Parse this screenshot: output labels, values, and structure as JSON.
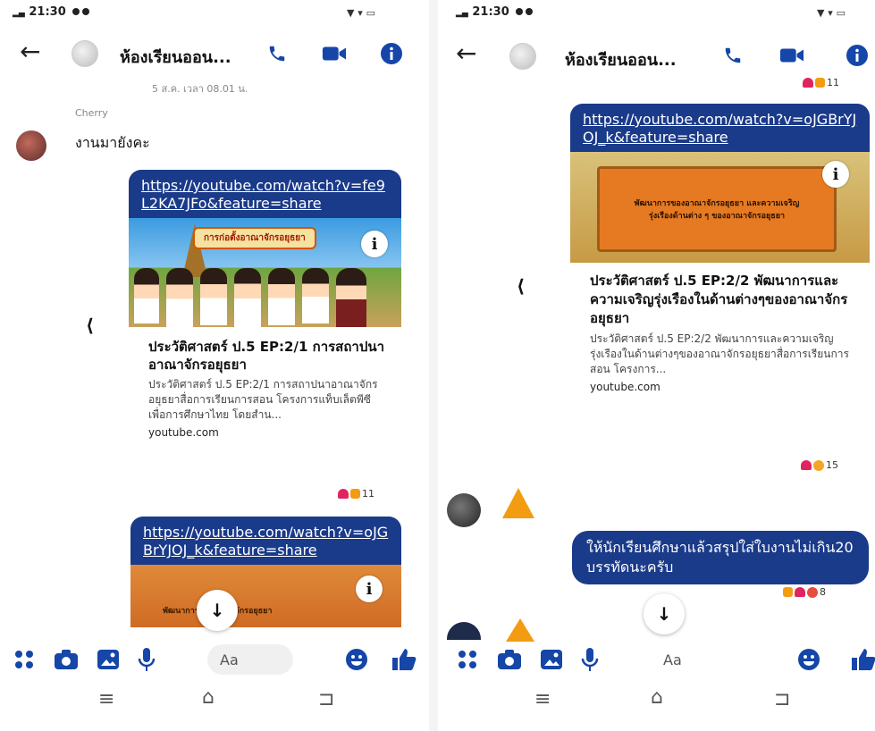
{
  "left": {
    "status": {
      "time": "21:30"
    },
    "header": {
      "title": "ห้องเรียนออน..."
    },
    "timestamp": "5 ส.ค. เวลา 08.01 น.",
    "sender_name": "Cherry",
    "message_text": "งานมายังคะ",
    "link1": {
      "url": "https://youtube.com/watch?v=fe9L2KA7JFo&feature=share",
      "thumb_banner": "การก่อตั้งอาณาจักรอยุธยา",
      "title": "ประวัติศาสตร์ ป.5 EP:2/1 การสถาปนาอาณาจักรอยุธยา",
      "desc": "ประวัติศาสตร์ ป.5 EP:2/1 การสถาปนาอาณาจักรอยุธยาสื่อการเรียนการสอน โครงการแท็บเล็ตพีซีเพื่อการศึกษาไทย โดยสำน...",
      "host": "youtube.com",
      "reaction_count": "11"
    },
    "link2": {
      "url": "https://youtube.com/watch?v=oJGBrYJOJ_k&feature=share",
      "thumb_banner": "พัฒนาการของอาณาจักรอยุธยา"
    },
    "composer": {
      "placeholder": "Aa"
    }
  },
  "right": {
    "status": {
      "time": "21:30"
    },
    "header": {
      "title": "ห้องเรียนออน..."
    },
    "top_reaction_count": "11",
    "link": {
      "url": "https://youtube.com/watch?v=oJGBrYJOJ_k&feature=share",
      "thumb_banner": "พัฒนาการของอาณาจักรอยุธยา และความเจริญรุ่งเรืองด้านต่าง ๆ ของอาณาจักรอยุธยา",
      "title": "ประวัติศาสตร์ ป.5 EP:2/2 พัฒนาการและความเจริญรุ่งเรืองในด้านต่างๆของอาณาจักรอยุธยา",
      "desc": "ประวัติศาสตร์ ป.5 EP:2/2 พัฒนาการและความเจริญรุ่งเรืองในด้านต่างๆของอาณาจักรอยุธยาสื่อการเรียนการสอน โครงการ...",
      "host": "youtube.com",
      "reaction_count": "15"
    },
    "message": {
      "text": "ให้นักเรียนศึกษาแล้วสรุปใส่ใบงานไม่เกิน20 บรรทัดนะครับ",
      "reaction_count": "8"
    },
    "composer": {
      "placeholder": "Aa"
    }
  },
  "colors": {
    "accent": "#1a3a8a",
    "icon_blue": "#1546a8"
  }
}
